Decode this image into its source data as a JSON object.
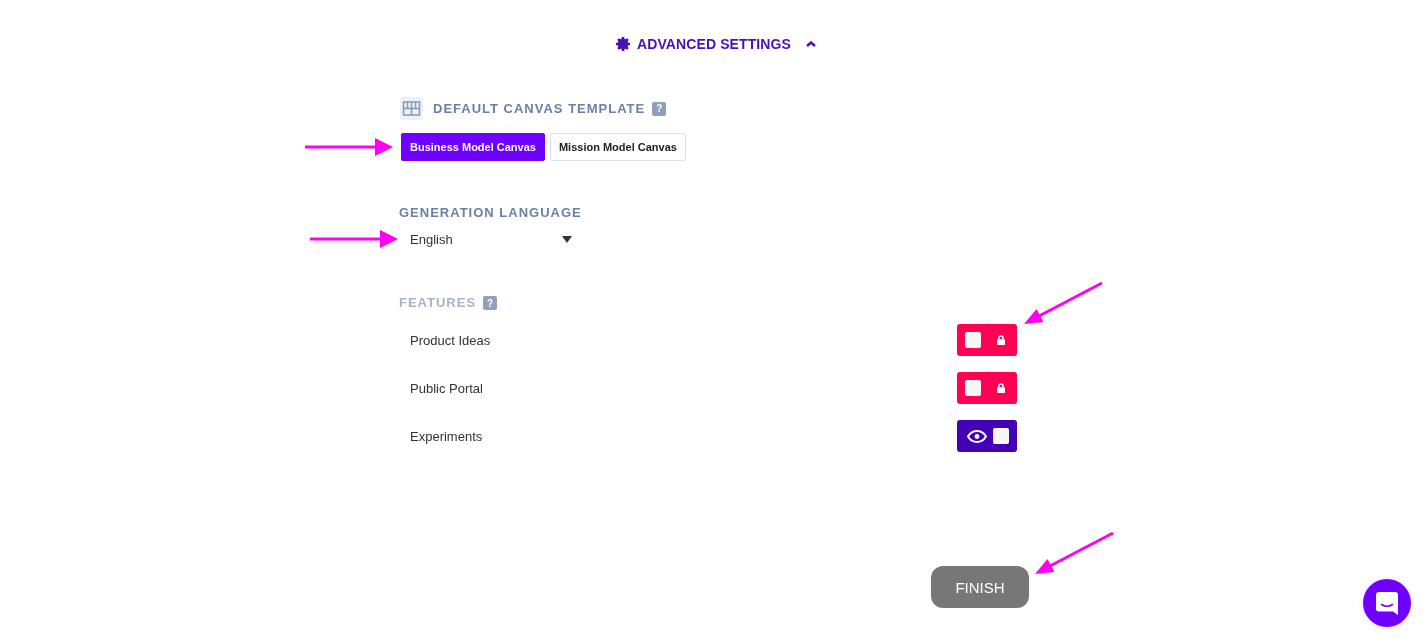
{
  "advanced_settings": {
    "title": "ADVANCED SETTINGS",
    "expanded": true
  },
  "canvas_template": {
    "heading": "DEFAULT CANVAS TEMPLATE",
    "help": "?",
    "options": [
      {
        "label": "Business Model Canvas",
        "selected": true,
        "arrow": true
      },
      {
        "label": "Mission Model Canvas",
        "selected": false,
        "arrow": false
      }
    ]
  },
  "generation_language": {
    "heading": "GENERATION LANGUAGE",
    "value": "English",
    "arrow": true
  },
  "features": {
    "heading": "FEATURES",
    "help": "?",
    "items": [
      {
        "label": "Product Ideas",
        "on": false,
        "locked": true,
        "arrow": true
      },
      {
        "label": "Public Portal",
        "on": false,
        "locked": true,
        "arrow": false
      },
      {
        "label": "Experiments",
        "on": true,
        "locked": false,
        "arrow": false
      }
    ]
  },
  "finish_button": {
    "label": "FINISH",
    "arrow": true
  }
}
